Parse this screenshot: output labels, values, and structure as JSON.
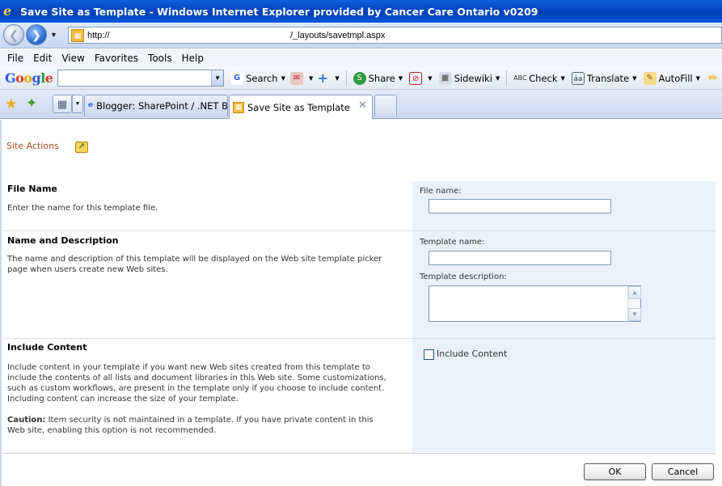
{
  "window": {
    "title": "Save Site as Template - Windows Internet Explorer provided by Cancer Care Ontario v0209"
  },
  "address": {
    "protocol": "http://",
    "path": "/_layouts/savetmpl.aspx"
  },
  "menu": [
    "File",
    "Edit",
    "View",
    "Favorites",
    "Tools",
    "Help"
  ],
  "google_toolbar": {
    "logo": [
      "G",
      "o",
      "o",
      "g",
      "l",
      "e"
    ],
    "search_label": "Search",
    "share_label": "Share",
    "sidewiki_label": "Sidewiki",
    "check_label": "Check",
    "translate_label": "Translate",
    "autofill_label": "AutoFill"
  },
  "tabs": [
    {
      "label": "Blogger: SharePoint / .NET Bl...",
      "active": false
    },
    {
      "label": "Save Site as Template",
      "active": true
    }
  ],
  "page": {
    "site_actions": "Site Actions",
    "sections": {
      "file_name": {
        "title": "File Name",
        "description": "Enter the name for this template file.",
        "field_label": "File name:",
        "value": ""
      },
      "name_description": {
        "title": "Name and Description",
        "description": "The name and description of this template will be displayed on the Web site template picker page when users create new Web sites.",
        "name_label": "Template name:",
        "name_value": "",
        "desc_label": "Template description:",
        "desc_value": ""
      },
      "include_content": {
        "title": "Include Content",
        "description": "Include content in your template if you want new Web sites created from this template to include the contents of all lists and document libraries in this Web site. Some customizations, such as custom workflows, are present in the template only if you choose to include content. Including content can increase the size of your template.",
        "caution_label": "Caution:",
        "caution_text": " Item security is not maintained in a template. If you have private content in this Web site, enabling this option is not recommended.",
        "checkbox_label": "Include Content",
        "checked": false
      }
    },
    "buttons": {
      "ok": "OK",
      "cancel": "Cancel"
    }
  }
}
